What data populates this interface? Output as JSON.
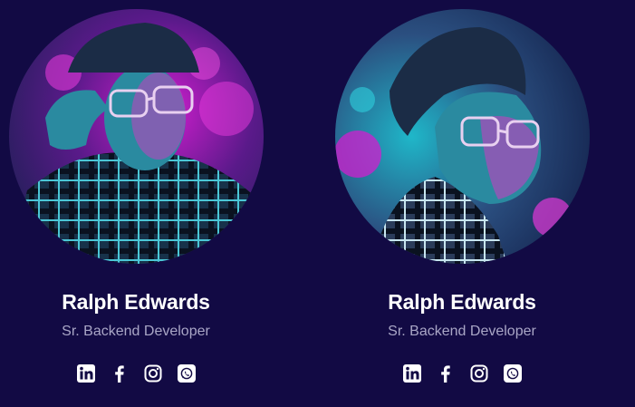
{
  "team": [
    {
      "name": "Ralph Edwards",
      "role": "Sr. Backend Developer",
      "socials": [
        "linkedin-icon",
        "facebook-icon",
        "instagram-icon",
        "whatsapp-icon"
      ]
    },
    {
      "name": "Ralph Edwards",
      "role": "Sr. Backend Developer",
      "socials": [
        "linkedin-icon",
        "facebook-icon",
        "instagram-icon",
        "whatsapp-icon"
      ]
    }
  ],
  "colors": {
    "background": "#120a44",
    "name": "#ffffff",
    "role": "#a9a6c6",
    "accent_magenta": "#d21ecf",
    "accent_cyan": "#1fb7c9"
  }
}
